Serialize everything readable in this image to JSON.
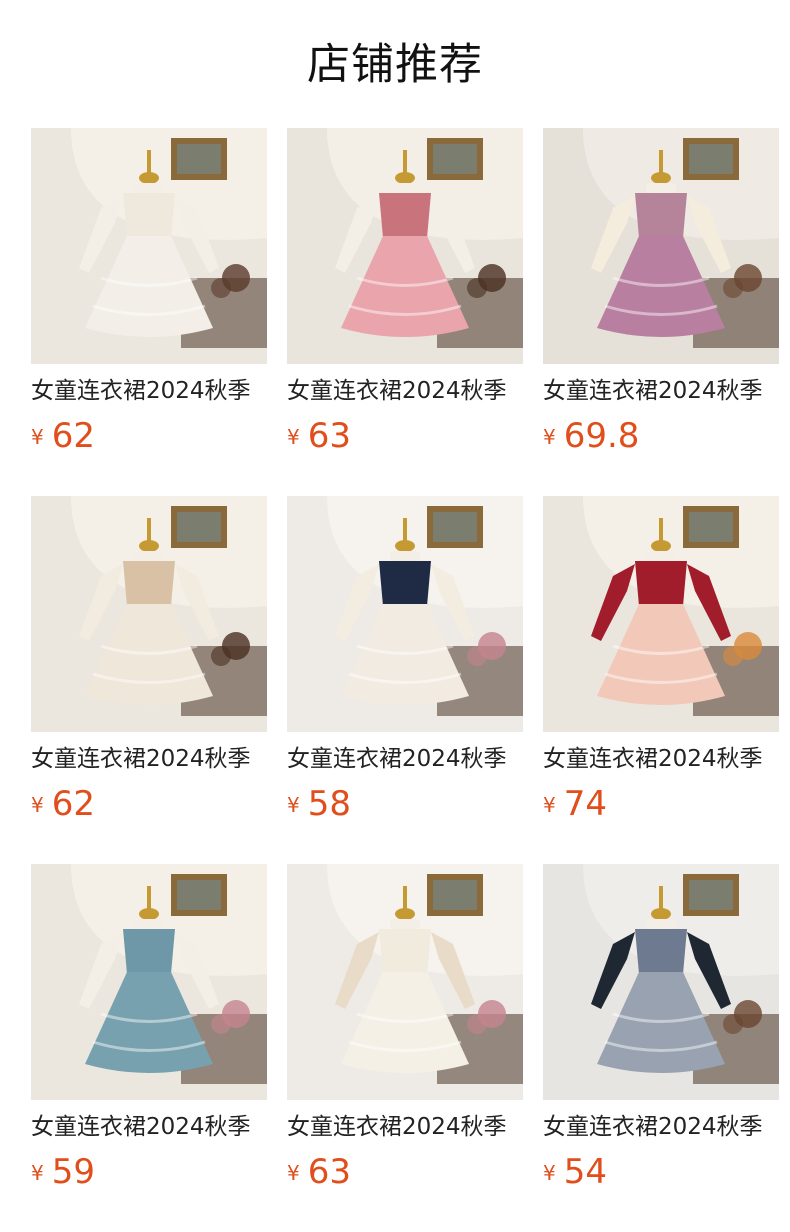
{
  "header": {
    "title": "店铺推荐"
  },
  "currency_symbol": "¥",
  "products": [
    {
      "name": "女童连衣裙2024秋季",
      "price": "62",
      "image": "dress-cream-bow",
      "colors": {
        "bg": "#ebe6de",
        "arch": "#f4f0e8",
        "bodice": "#efe9dd",
        "skirt": "#f3efe8",
        "sleeve": "#f4efe6",
        "accent": "#5a3a2a"
      }
    },
    {
      "name": "女童连衣裙2024秋季",
      "price": "63",
      "image": "dress-pink-tiered",
      "colors": {
        "bg": "#e9e4dc",
        "arch": "#f3efe7",
        "bodice": "#c9737d",
        "skirt": "#e9a4ac",
        "sleeve": "#f4efe6",
        "accent": "#4a3022"
      }
    },
    {
      "name": "女童连衣裙2024秋季",
      "price": "69.8",
      "image": "dress-mauve-ruffle",
      "colors": {
        "bg": "#e6e1d8",
        "arch": "#efebe4",
        "bodice": "#b5849b",
        "skirt": "#b97fa0",
        "sleeve": "#f4ecdc",
        "accent": "#6a4630"
      }
    },
    {
      "name": "女童连衣裙2024秋季",
      "price": "62",
      "image": "dress-champagne-tiered",
      "colors": {
        "bg": "#ebe6de",
        "arch": "#f4f0e8",
        "bodice": "#d9c1a6",
        "skirt": "#efe7da",
        "sleeve": "#f2ebdf",
        "accent": "#4a3022"
      }
    },
    {
      "name": "女童连衣裙2024秋季",
      "price": "58",
      "image": "dress-navy-sequin",
      "colors": {
        "bg": "#eeebe6",
        "arch": "#f6f3ee",
        "bodice": "#1f2a44",
        "skirt": "#f2ebe2",
        "sleeve": "#f3ece1",
        "accent": "#c5838e"
      }
    },
    {
      "name": "女童连衣裙2024秋季",
      "price": "74",
      "image": "dress-red-velvet",
      "colors": {
        "bg": "#eae5dd",
        "arch": "#f4f0e8",
        "bodice": "#a11d2c",
        "skirt": "#f2c9b9",
        "sleeve": "#a11d2c",
        "accent": "#d98a3a"
      }
    },
    {
      "name": "女童连衣裙2024秋季",
      "price": "59",
      "image": "dress-blue-smocked",
      "colors": {
        "bg": "#ebe6de",
        "arch": "#f4f0e8",
        "bodice": "#6e98a8",
        "skirt": "#78a1b0",
        "sleeve": "#f4efe6",
        "accent": "#c5838e"
      }
    },
    {
      "name": "女童连衣裙2024秋季",
      "price": "63",
      "image": "dress-ivory-lace",
      "colors": {
        "bg": "#eeebe6",
        "arch": "#f6f3ee",
        "bodice": "#f1ebde",
        "skirt": "#f5f0e6",
        "sleeve": "#e8dcc8",
        "accent": "#c5838e"
      }
    },
    {
      "name": "女童连衣裙2024秋季",
      "price": "54",
      "image": "dress-grey-tulle",
      "colors": {
        "bg": "#e7e5e1",
        "arch": "#efedea",
        "bodice": "#6d7a90",
        "skirt": "#98a2b0",
        "sleeve": "#1f2733",
        "accent": "#6a4630"
      }
    }
  ]
}
